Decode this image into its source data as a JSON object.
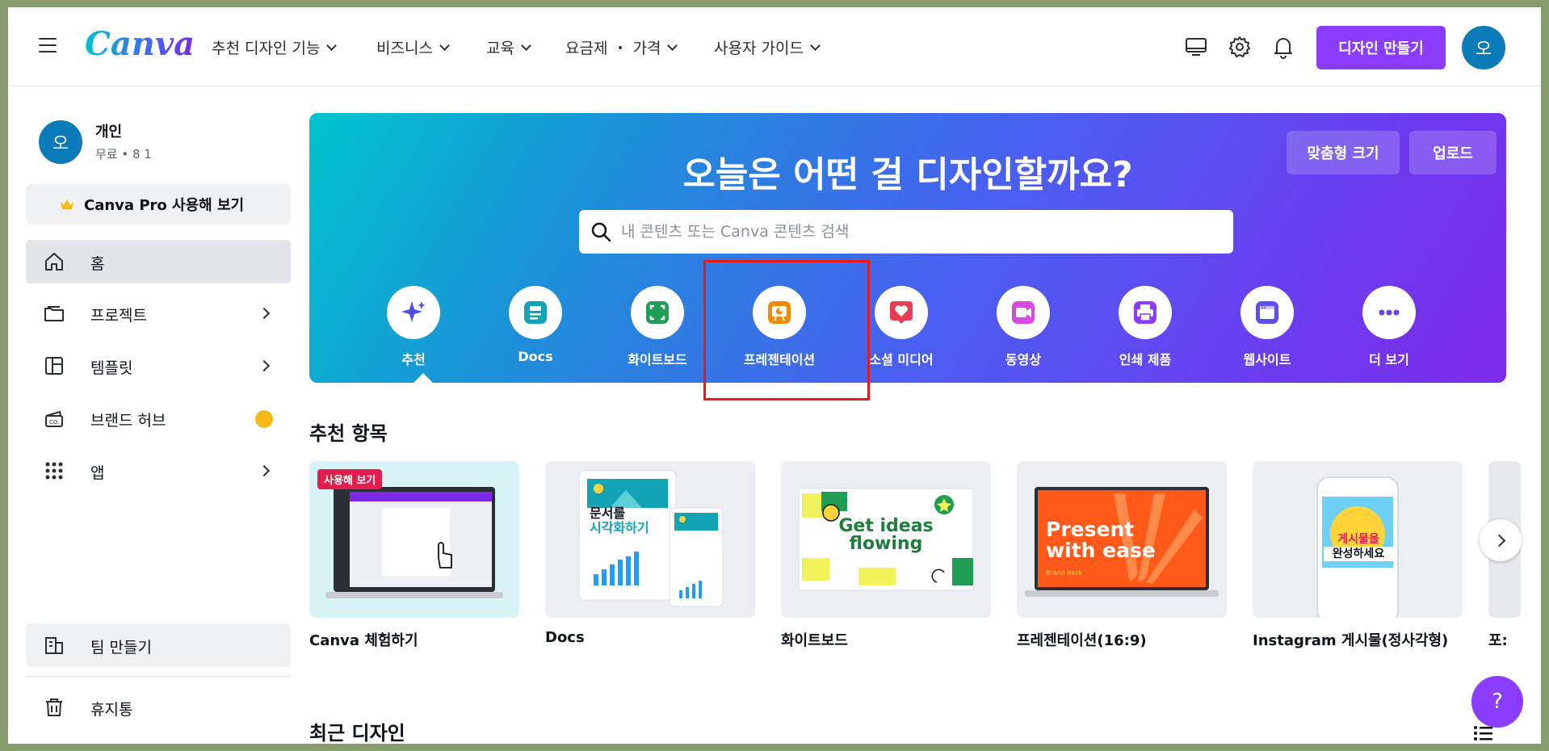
{
  "nav": {
    "items": [
      {
        "label": "추천 디자인 기능"
      },
      {
        "label": "비즈니스"
      },
      {
        "label": "교육"
      },
      {
        "label": "요금제 ・ 가격"
      },
      {
        "label": "사용자 가이드"
      }
    ],
    "create_label": "디자인 만들기",
    "avatar_initial": "오"
  },
  "sidebar": {
    "profile": {
      "initial": "오",
      "name": "개인",
      "sub": "무료 • 8 1"
    },
    "pro_label": "Canva Pro 사용해 보기",
    "items": [
      {
        "label": "홈"
      },
      {
        "label": "프로젝트"
      },
      {
        "label": "템플릿"
      },
      {
        "label": "브랜드 허브"
      },
      {
        "label": "앱"
      }
    ],
    "team_label": "팀 만들기",
    "trash_label": "휴지통"
  },
  "hero": {
    "title": "오늘은 어떤 걸 디자인할까요?",
    "custom_size_label": "맞춤형 크기",
    "upload_label": "업로드",
    "search_placeholder": "내 콘텐츠 또는 Canva 콘텐츠 검색",
    "categories": [
      {
        "label": "추천",
        "icon": "sparkle-icon"
      },
      {
        "label": "Docs",
        "icon": "docs-icon"
      },
      {
        "label": "화이트보드",
        "icon": "whiteboard-icon"
      },
      {
        "label": "프레젠테이션",
        "icon": "presentation-icon"
      },
      {
        "label": "소셜 미디어",
        "icon": "heart-icon"
      },
      {
        "label": "동영상",
        "icon": "video-icon"
      },
      {
        "label": "인쇄 제품",
        "icon": "printer-icon"
      },
      {
        "label": "웹사이트",
        "icon": "website-icon"
      },
      {
        "label": "더 보기",
        "icon": "more-icon"
      }
    ]
  },
  "recommended": {
    "title": "추천 항목",
    "cards": [
      {
        "title": "Canva 체험하기",
        "badge": "사용해 보기"
      },
      {
        "title": "Docs",
        "thumb_text": [
          "문서를",
          "시각화하기"
        ]
      },
      {
        "title": "화이트보드",
        "thumb_text": [
          "Get ideas",
          "flowing"
        ]
      },
      {
        "title": "프레젠테이션(16:9)",
        "thumb_text": [
          "Present",
          "with ease",
          "Brand deck"
        ]
      },
      {
        "title": "Instagram 게시물(정사각형)",
        "thumb_text": [
          "게시물을",
          "완성하세요"
        ]
      },
      {
        "title": "포:"
      }
    ]
  },
  "recent": {
    "title": "최근 디자인"
  },
  "help_label": "?",
  "colors": {
    "accent": "#8b3dff",
    "avatar": "#0a7bb8",
    "highlight": "#e21b1b"
  }
}
